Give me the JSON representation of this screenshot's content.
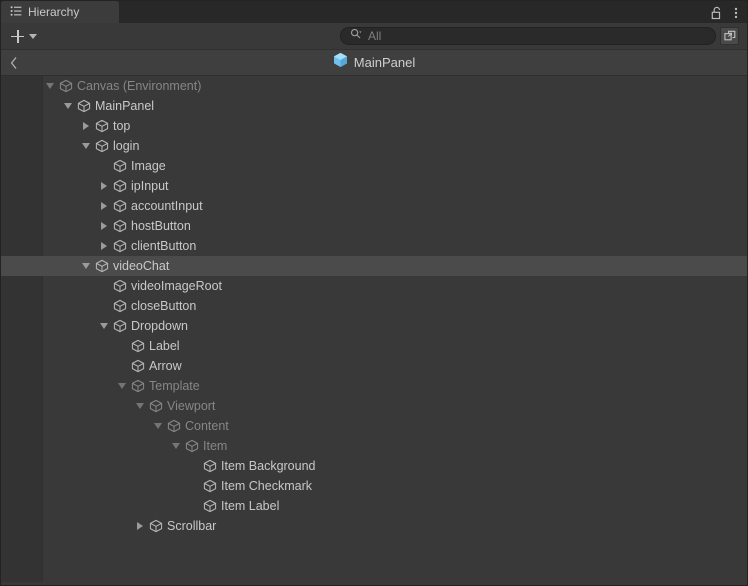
{
  "window": {
    "title": "Hierarchy"
  },
  "tabbar": {
    "tab_label": "Hierarchy",
    "tab_icon": "hierarchy-list-icon",
    "lock_icon": "lock-open-icon",
    "menu_icon": "kebab-menu-icon"
  },
  "toolbar": {
    "create_label": "+",
    "create_icon": "plus-icon",
    "create_dropdown_icon": "chevron-down-icon",
    "search": {
      "icon": "search-icon",
      "placeholder": "All",
      "value": "",
      "save_icon": "save-search-icon"
    }
  },
  "breadcrumb": {
    "back_icon": "chevron-left-icon",
    "prefab_icon": "prefab-cube-icon",
    "label": "MainPanel",
    "prefab_color": "#7ec8f2"
  },
  "colors": {
    "panel_background": "#393939",
    "tabbar_background": "#282828",
    "active_tab": "#3c3c3c",
    "breadcrumb_background": "#3f3f3f",
    "gutter": "#333333",
    "selection": "#4b4b4b",
    "text": "#c8c8c8",
    "text_dim": "#868686"
  },
  "tree": {
    "rows": [
      {
        "label": "Canvas (Environment)",
        "depth": 0,
        "twisty": "down",
        "dim": true,
        "selected": false,
        "icon": "gameobject-cube-icon"
      },
      {
        "label": "MainPanel",
        "depth": 1,
        "twisty": "down",
        "dim": false,
        "selected": false,
        "icon": "gameobject-cube-icon"
      },
      {
        "label": "top",
        "depth": 2,
        "twisty": "right",
        "dim": false,
        "selected": false,
        "icon": "gameobject-cube-icon"
      },
      {
        "label": "login",
        "depth": 2,
        "twisty": "down",
        "dim": false,
        "selected": false,
        "icon": "gameobject-cube-icon"
      },
      {
        "label": "Image",
        "depth": 3,
        "twisty": "none",
        "dim": false,
        "selected": false,
        "icon": "gameobject-cube-icon"
      },
      {
        "label": "ipInput",
        "depth": 3,
        "twisty": "right",
        "dim": false,
        "selected": false,
        "icon": "gameobject-cube-icon"
      },
      {
        "label": "accountInput",
        "depth": 3,
        "twisty": "right",
        "dim": false,
        "selected": false,
        "icon": "gameobject-cube-icon"
      },
      {
        "label": "hostButton",
        "depth": 3,
        "twisty": "right",
        "dim": false,
        "selected": false,
        "icon": "gameobject-cube-icon"
      },
      {
        "label": "clientButton",
        "depth": 3,
        "twisty": "right",
        "dim": false,
        "selected": false,
        "icon": "gameobject-cube-icon"
      },
      {
        "label": "videoChat",
        "depth": 2,
        "twisty": "down",
        "dim": false,
        "selected": true,
        "icon": "gameobject-cube-icon"
      },
      {
        "label": "videoImageRoot",
        "depth": 3,
        "twisty": "none",
        "dim": false,
        "selected": false,
        "icon": "gameobject-cube-icon"
      },
      {
        "label": "closeButton",
        "depth": 3,
        "twisty": "none",
        "dim": false,
        "selected": false,
        "icon": "gameobject-cube-icon"
      },
      {
        "label": "Dropdown",
        "depth": 3,
        "twisty": "down",
        "dim": false,
        "selected": false,
        "icon": "gameobject-cube-icon"
      },
      {
        "label": "Label",
        "depth": 4,
        "twisty": "none",
        "dim": false,
        "selected": false,
        "icon": "gameobject-cube-icon"
      },
      {
        "label": "Arrow",
        "depth": 4,
        "twisty": "none",
        "dim": false,
        "selected": false,
        "icon": "gameobject-cube-icon"
      },
      {
        "label": "Template",
        "depth": 4,
        "twisty": "down",
        "dim": true,
        "selected": false,
        "icon": "gameobject-cube-icon"
      },
      {
        "label": "Viewport",
        "depth": 5,
        "twisty": "down",
        "dim": true,
        "selected": false,
        "icon": "gameobject-cube-icon"
      },
      {
        "label": "Content",
        "depth": 6,
        "twisty": "down",
        "dim": true,
        "selected": false,
        "icon": "gameobject-cube-icon"
      },
      {
        "label": "Item",
        "depth": 7,
        "twisty": "down",
        "dim": true,
        "selected": false,
        "icon": "gameobject-cube-icon"
      },
      {
        "label": "Item Background",
        "depth": 8,
        "twisty": "none",
        "dim": false,
        "selected": false,
        "icon": "gameobject-cube-icon"
      },
      {
        "label": "Item Checkmark",
        "depth": 8,
        "twisty": "none",
        "dim": false,
        "selected": false,
        "icon": "gameobject-cube-icon"
      },
      {
        "label": "Item Label",
        "depth": 8,
        "twisty": "none",
        "dim": false,
        "selected": false,
        "icon": "gameobject-cube-icon"
      },
      {
        "label": "Scrollbar",
        "depth": 5,
        "twisty": "right",
        "dim": false,
        "selected": false,
        "icon": "gameobject-cube-icon"
      }
    ]
  }
}
